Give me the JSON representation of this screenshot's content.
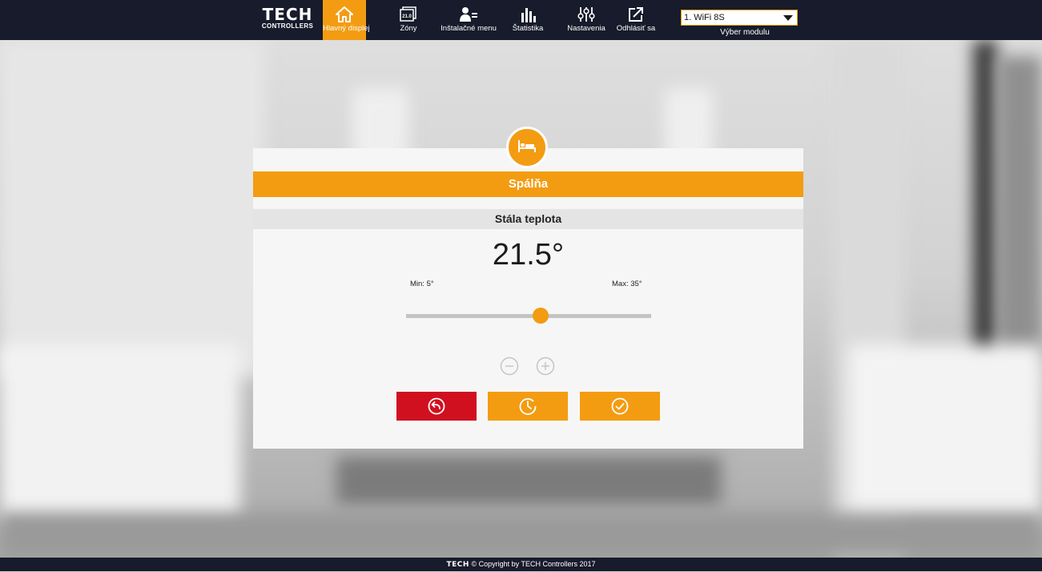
{
  "header": {
    "logo_big": "TECH",
    "logo_small": "CONTROLLERS",
    "nav": [
      {
        "label": "Hlavný displej",
        "icon": "home-icon"
      },
      {
        "label": "Zóny",
        "icon": "zones-icon"
      },
      {
        "label": "Inštalačné menu",
        "icon": "installer-icon"
      },
      {
        "label": "Štatistika",
        "icon": "statistics-icon"
      },
      {
        "label": "Nastavenia",
        "icon": "settings-icon"
      },
      {
        "label": "Odhlásiť sa",
        "icon": "logout-icon"
      }
    ],
    "zones_icon_text": "21.0",
    "module_select": {
      "value": "1. WiFi 8S",
      "caption": "Výber modulu"
    }
  },
  "zone_dialog": {
    "icon": "bed-icon",
    "title": "Spálňa",
    "mode": "Stála teplota",
    "temperature": "21.5°",
    "temperature_value": 21.5,
    "min_label": "Min: 5°",
    "max_label": "Max: 35°",
    "min_value": 5,
    "max_value": 35
  },
  "footer": {
    "brand": "TECH",
    "copyright": "© Copyright by TECH Controllers 2017"
  },
  "colors": {
    "accent": "#f39c12",
    "topbar": "#171b2b",
    "cancel": "#d0101f"
  }
}
